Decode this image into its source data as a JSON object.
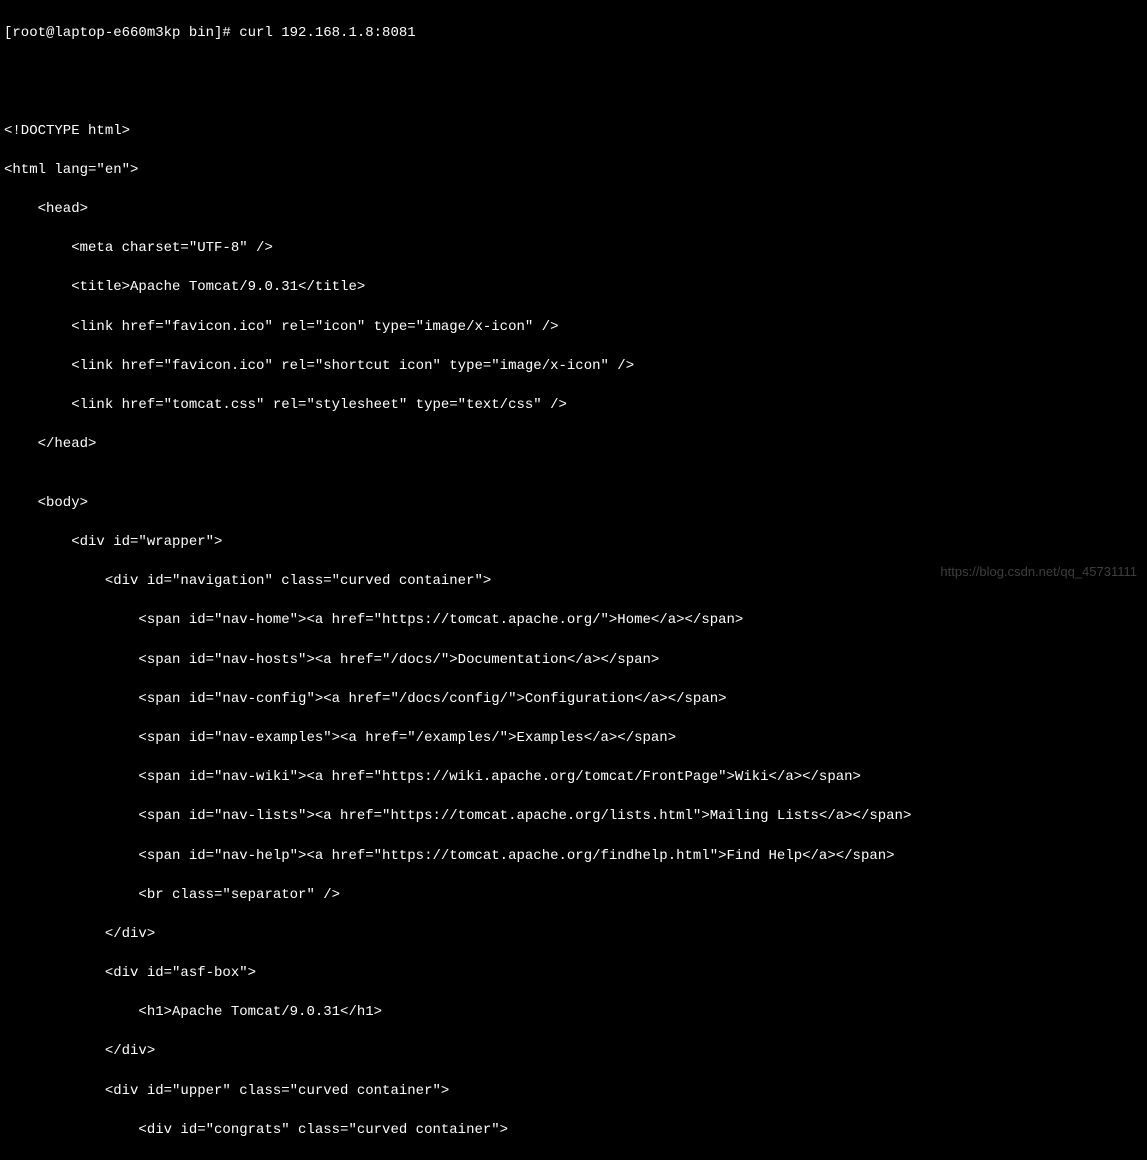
{
  "terminal": {
    "prompt": "[root@laptop-e660m3kp bin]# curl 192.168.1.8:8081",
    "blank1": "",
    "blank2": "",
    "blank3": "",
    "line_doctype": "<!DOCTYPE html>",
    "line_html": "<html lang=\"en\">",
    "line_head": "    <head>",
    "line_meta": "        <meta charset=\"UTF-8\" />",
    "line_title": "        <title>Apache Tomcat/9.0.31</title>",
    "line_link1": "        <link href=\"favicon.ico\" rel=\"icon\" type=\"image/x-icon\" />",
    "line_link2": "        <link href=\"favicon.ico\" rel=\"shortcut icon\" type=\"image/x-icon\" />",
    "line_link3": "        <link href=\"tomcat.css\" rel=\"stylesheet\" type=\"text/css\" />",
    "line_headend": "    </head>",
    "blank4": "",
    "line_body": "    <body>",
    "line_wrapper": "        <div id=\"wrapper\">",
    "line_nav": "            <div id=\"navigation\" class=\"curved container\">",
    "line_navhome": "                <span id=\"nav-home\"><a href=\"https://tomcat.apache.org/\">Home</a></span>",
    "line_navhosts": "                <span id=\"nav-hosts\"><a href=\"/docs/\">Documentation</a></span>",
    "line_navconfig": "                <span id=\"nav-config\"><a href=\"/docs/config/\">Configuration</a></span>",
    "line_navexamples": "                <span id=\"nav-examples\"><a href=\"/examples/\">Examples</a></span>",
    "line_navwiki": "                <span id=\"nav-wiki\"><a href=\"https://wiki.apache.org/tomcat/FrontPage\">Wiki</a></span>",
    "line_navlists": "                <span id=\"nav-lists\"><a href=\"https://tomcat.apache.org/lists.html\">Mailing Lists</a></span>",
    "line_navhelp": "                <span id=\"nav-help\"><a href=\"https://tomcat.apache.org/findhelp.html\">Find Help</a></span>",
    "line_br": "                <br class=\"separator\" />",
    "line_navend": "            </div>",
    "line_asfbox": "            <div id=\"asf-box\">",
    "line_h1": "                <h1>Apache Tomcat/9.0.31</h1>",
    "line_asfend": "            </div>",
    "line_upper": "            <div id=\"upper\" class=\"curved container\">",
    "line_congrats": "                <div id=\"congrats\" class=\"curved container\">"
  },
  "watermark": "https://blog.csdn.net/qq_45731111"
}
